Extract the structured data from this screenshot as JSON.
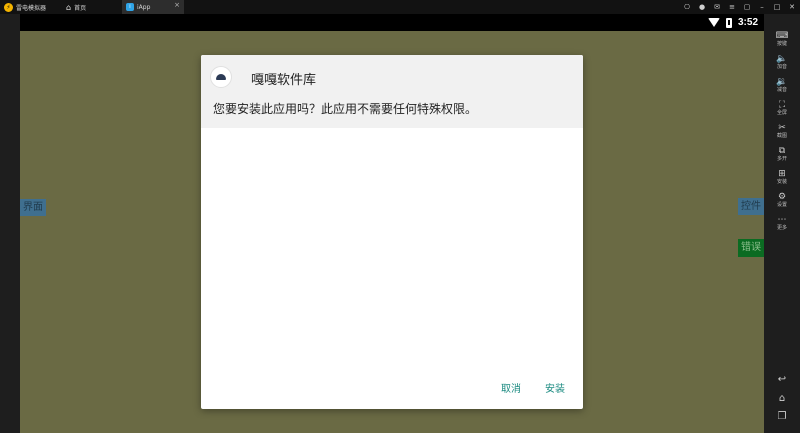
{
  "window": {
    "tabs": [
      {
        "label": "雷电模拟器",
        "icon": "emulator-logo-icon"
      },
      {
        "label": "首页",
        "icon": "home-icon"
      },
      {
        "label": "iApp",
        "icon": "iapp-app-icon"
      }
    ],
    "tab_close_icon": "close-icon",
    "controls": [
      "gamepad-icon",
      "account-icon",
      "mail-icon",
      "menu-icon",
      "restore-icon",
      "minimize-icon",
      "maximize-icon",
      "close-icon"
    ]
  },
  "statusbar": {
    "time": "3:52",
    "icons": [
      "wifi-icon",
      "battery-icon"
    ]
  },
  "screen": {
    "background_color": "#6a6a44",
    "labels": {
      "left": "界面",
      "right_top": "控件",
      "right_bottom": "错误"
    }
  },
  "dialog": {
    "app_name": "嘎嘎软件库",
    "message": "您要安装此应用吗？此应用不需要任何特殊权限。",
    "cancel_label": "取消",
    "install_label": "安装",
    "accent_color": "#1a8a80"
  },
  "toolbar": {
    "items": [
      {
        "label": "按键",
        "icon": "keyboard-icon"
      },
      {
        "label": "加音",
        "icon": "volume-up-icon"
      },
      {
        "label": "减音",
        "icon": "volume-down-icon"
      },
      {
        "label": "全屏",
        "icon": "fullscreen-icon"
      },
      {
        "label": "截图",
        "icon": "scissors-icon"
      },
      {
        "label": "多开",
        "icon": "multi-instance-icon"
      },
      {
        "label": "安装",
        "icon": "install-apk-icon"
      },
      {
        "label": "设置",
        "icon": "settings-icon"
      },
      {
        "label": "更多",
        "icon": "more-icon"
      }
    ],
    "nav": [
      "back-icon",
      "home-icon",
      "recent-apps-icon"
    ]
  }
}
